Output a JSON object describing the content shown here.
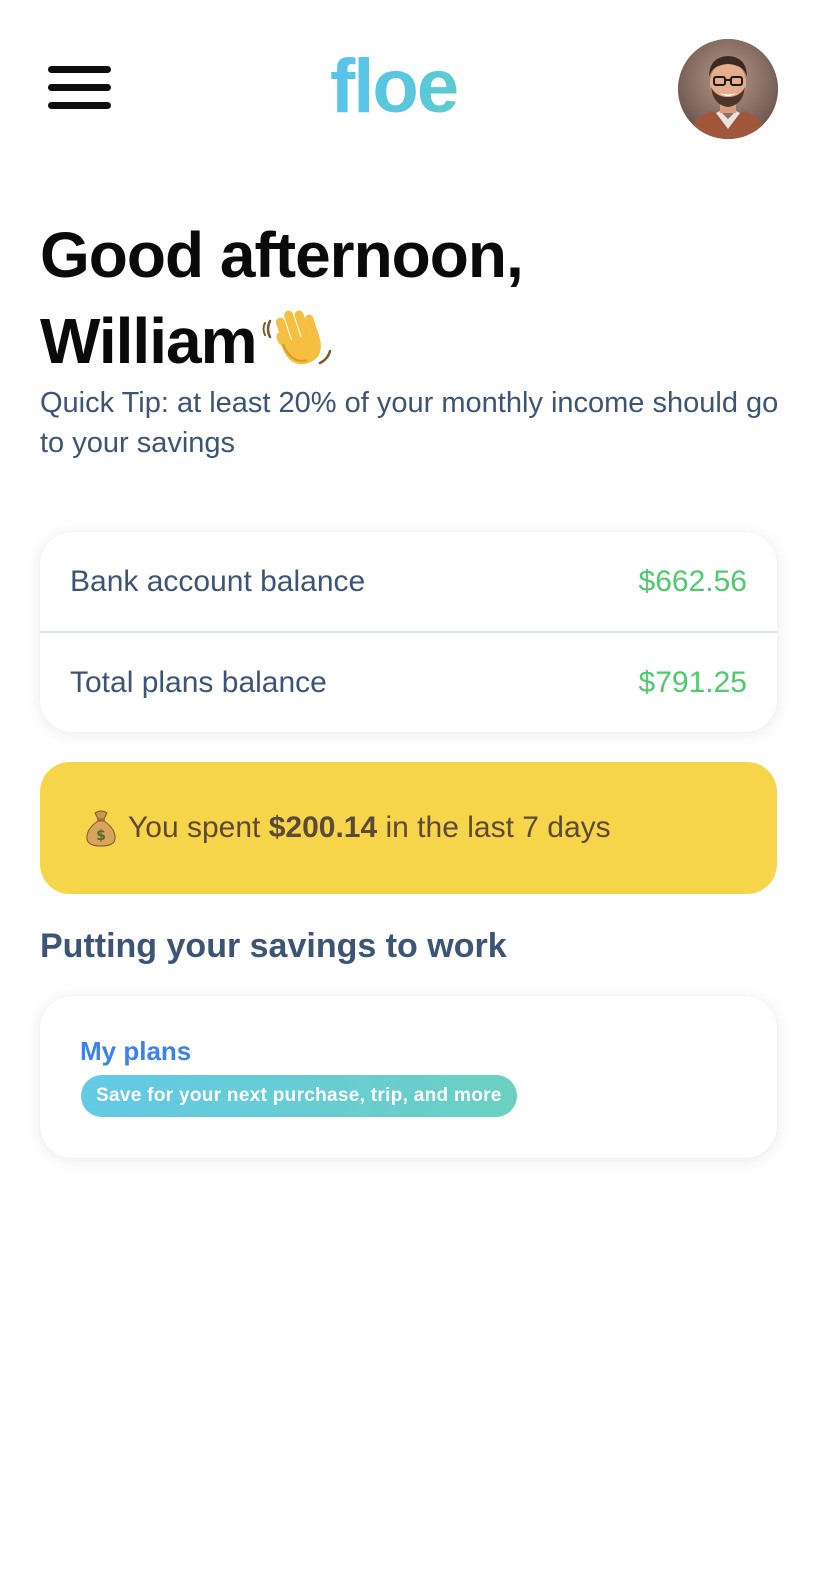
{
  "header": {
    "logo_text": "floe",
    "menu_icon": "hamburger-menu-icon",
    "avatar_icon": "user-avatar"
  },
  "greeting": {
    "line1": "Good afternoon,",
    "line2": "William",
    "emoji_icon": "waving-hand-icon",
    "tip": "Quick Tip: at least 20% of your monthly income should go to your savings"
  },
  "balances": [
    {
      "label": "Bank account balance",
      "value": "$662.56"
    },
    {
      "label": "Total plans balance",
      "value": "$791.25"
    }
  ],
  "spent": {
    "icon": "money-bag-icon",
    "prefix": "You spent",
    "amount": "$200.14",
    "suffix": "in the last 7 days"
  },
  "savings_section": {
    "title": "Putting your savings to work",
    "card_title": "My plans",
    "card_pill": "Save for your next purchase, trip, and more"
  },
  "colors": {
    "accent_blue": "#3b82f0",
    "balance_green": "#4ccb6c",
    "banner_yellow": "#f7d54a",
    "text_slate": "#3d5475",
    "logo_gradient_start": "#58c3ee",
    "logo_gradient_end": "#5ccdc5"
  }
}
